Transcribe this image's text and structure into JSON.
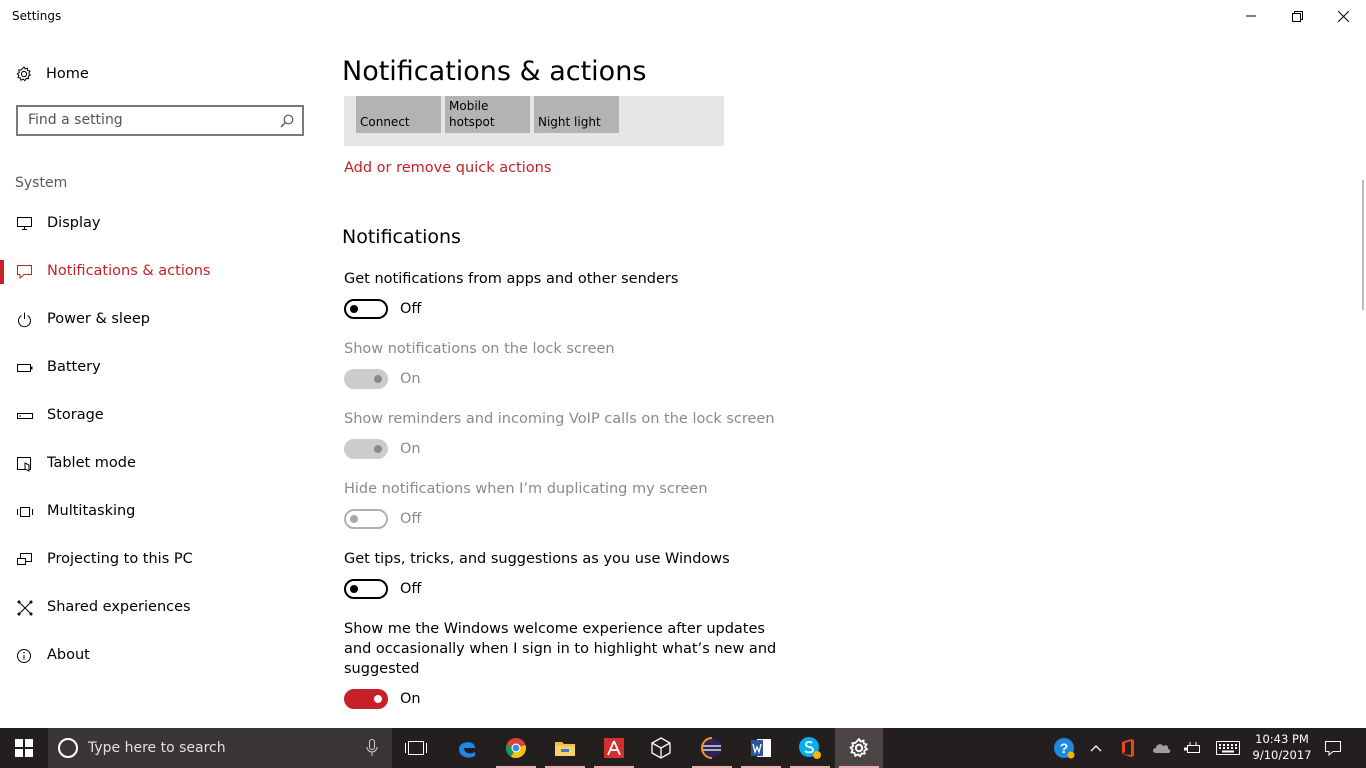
{
  "window": {
    "title": "Settings"
  },
  "sidebar": {
    "home_label": "Home",
    "search_placeholder": "Find a setting",
    "section_label": "System",
    "items": [
      {
        "label": "Display",
        "icon": "monitor-icon"
      },
      {
        "label": "Notifications & actions",
        "icon": "message-icon",
        "active": true
      },
      {
        "label": "Power & sleep",
        "icon": "power-icon"
      },
      {
        "label": "Battery",
        "icon": "battery-icon"
      },
      {
        "label": "Storage",
        "icon": "storage-icon"
      },
      {
        "label": "Tablet mode",
        "icon": "tablet-mode-icon"
      },
      {
        "label": "Multitasking",
        "icon": "multitasking-icon"
      },
      {
        "label": "Projecting to this PC",
        "icon": "projecting-icon"
      },
      {
        "label": "Shared experiences",
        "icon": "shared-experiences-icon"
      },
      {
        "label": "About",
        "icon": "info-icon"
      }
    ]
  },
  "main": {
    "title": "Notifications & actions",
    "quick_actions": [
      {
        "label": "Connect"
      },
      {
        "label": "Mobile hotspot"
      },
      {
        "label": "Night light"
      }
    ],
    "quick_actions_link": "Add or remove quick actions",
    "notifications_title": "Notifications",
    "settings": [
      {
        "label": "Get notifications from apps and other senders",
        "state": "Off",
        "enabled": true
      },
      {
        "label": "Show notifications on the lock screen",
        "state": "On",
        "enabled": false
      },
      {
        "label": "Show reminders and incoming VoIP calls on the lock screen",
        "state": "On",
        "enabled": false
      },
      {
        "label": "Hide notifications when I’m duplicating my screen",
        "state": "Off",
        "enabled": false
      },
      {
        "label": "Get tips, tricks, and suggestions as you use Windows",
        "state": "Off",
        "enabled": true
      },
      {
        "label": "Show me the Windows welcome experience after updates and occasionally when I sign in to highlight what’s new and suggested",
        "state": "On",
        "enabled": true
      }
    ]
  },
  "taskbar": {
    "search_placeholder": "Type here to search",
    "time": "10:43 PM",
    "date": "9/10/2017",
    "apps": [
      "task-view-icon",
      "edge-icon",
      "chrome-icon",
      "file-explorer-icon",
      "acrobat-icon",
      "virtualbox-icon",
      "eclipse-icon",
      "word-icon",
      "skype-icon",
      "settings-icon"
    ],
    "tray": [
      "help-icon",
      "chevron-up-icon",
      "office-icon",
      "onedrive-icon",
      "power-plug-icon",
      "keyboard-icon",
      "action-center-icon"
    ]
  },
  "colors": {
    "accent": "#c62128",
    "taskbar": "#231f1f"
  }
}
